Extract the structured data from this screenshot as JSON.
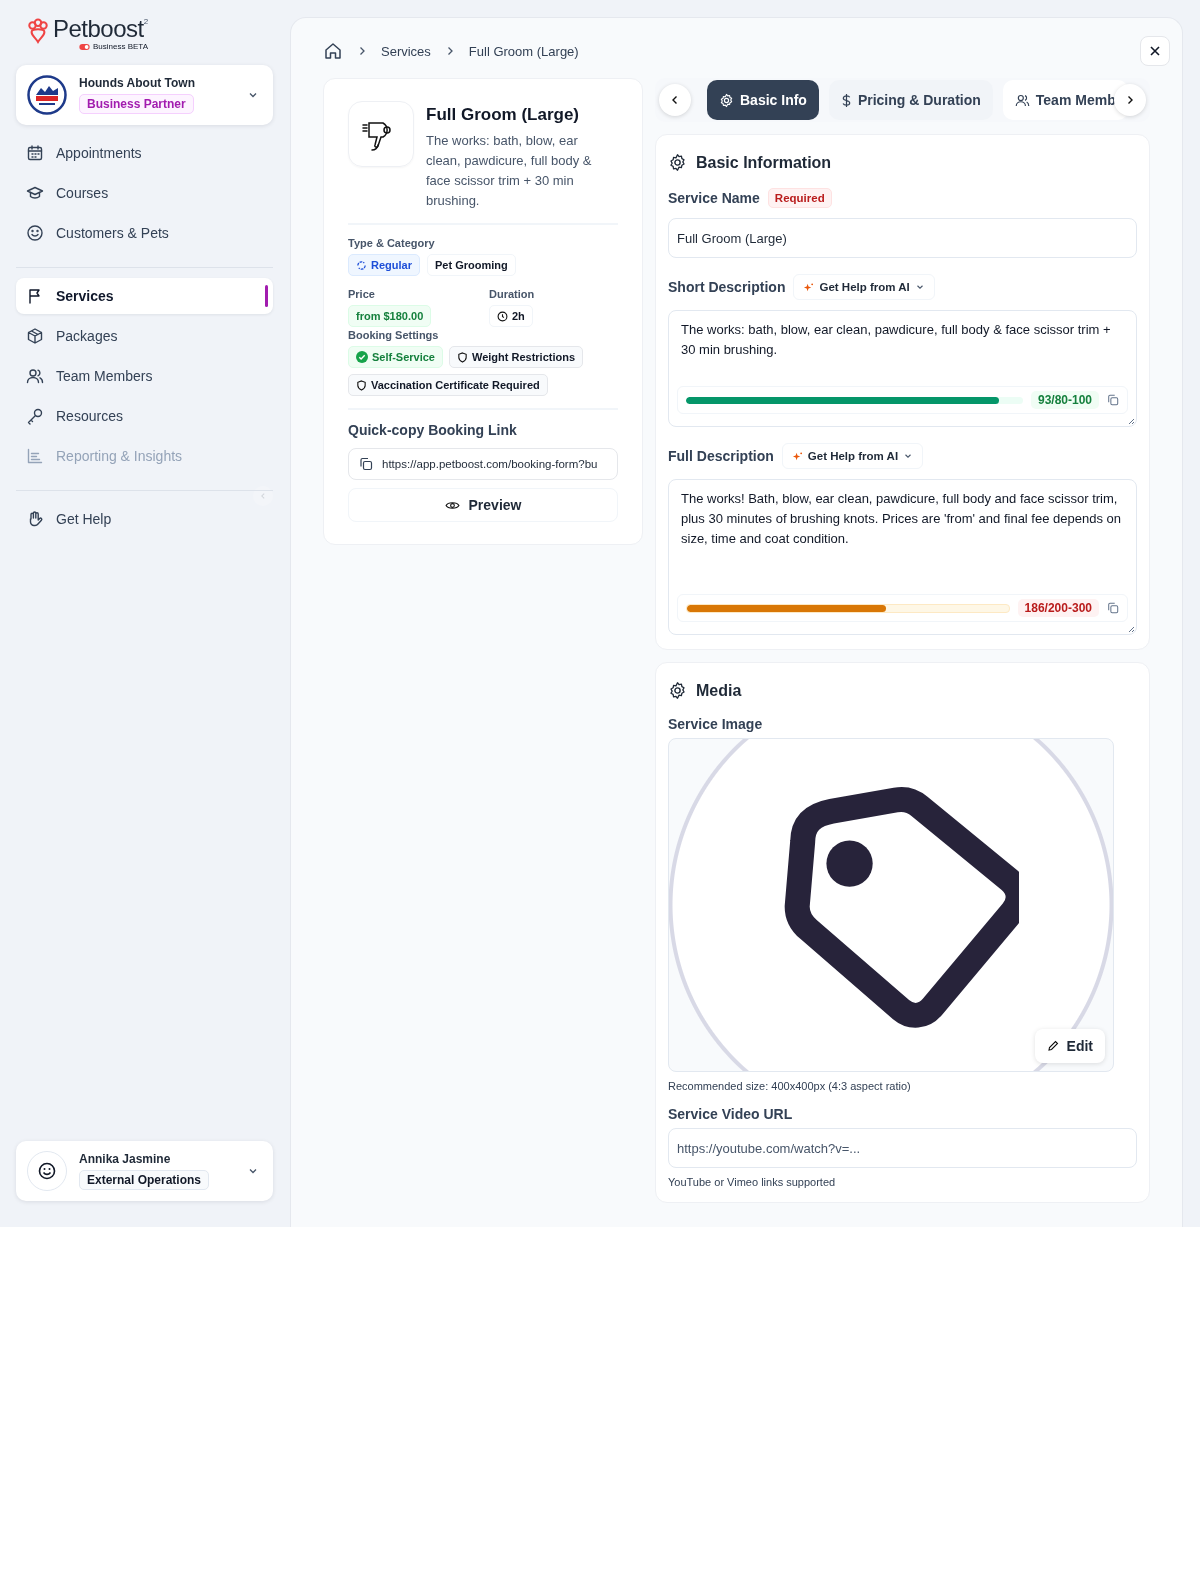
{
  "brand": {
    "name": "Petboost",
    "mark": "2",
    "edition": "Business BETA"
  },
  "business": {
    "name": "Hounds About Town",
    "role": "Business Partner"
  },
  "nav": [
    [
      {
        "label": "Appointments",
        "selected": false,
        "disabled": false
      },
      {
        "label": "Courses",
        "selected": false,
        "disabled": false
      },
      {
        "label": "Customers & Pets",
        "selected": false,
        "disabled": false
      }
    ],
    [
      {
        "label": "Services",
        "selected": true,
        "disabled": false
      },
      {
        "label": "Packages",
        "selected": false,
        "disabled": false
      },
      {
        "label": "Team Members",
        "selected": false,
        "disabled": false
      },
      {
        "label": "Resources",
        "selected": false,
        "disabled": false
      },
      {
        "label": "Reporting & Insights",
        "selected": false,
        "disabled": true
      }
    ],
    [
      {
        "label": "Get Help",
        "selected": false,
        "disabled": false
      }
    ]
  ],
  "user": {
    "name": "Annika Jasmine",
    "role": "External Operations"
  },
  "breadcrumb": [
    "Services",
    "Full Groom (Large)"
  ],
  "summary": {
    "title": "Full Groom (Large)",
    "description": "The works: bath, blow, ear clean, pawdicure, full body & face scissor trim + 30 min brushing.",
    "type_label": "Type & Category",
    "type": "Regular",
    "category": "Pet Grooming",
    "price_label": "Price",
    "price": "from $180.00",
    "duration_label": "Duration",
    "duration": "2h",
    "booking_label": "Booking Settings",
    "booking_settings": [
      {
        "label": "Self-Service",
        "kind": "enabled"
      },
      {
        "label": "Weight Restrictions",
        "kind": "rule"
      },
      {
        "label": "Vaccination Certificate Required",
        "kind": "rule"
      }
    ],
    "link_label": "Quick-copy Booking Link",
    "link": "https://app.petboost.com/booking-form?bu",
    "preview": "Preview"
  },
  "tabs": [
    {
      "label": "Basic Info",
      "selected": true
    },
    {
      "label": "Pricing & Duration",
      "selected": false
    },
    {
      "label": "Team Memb",
      "selected": false
    }
  ],
  "basic": {
    "title": "Basic Information",
    "name_label": "Service Name",
    "required": "Required",
    "name_value": "Full Groom (Large)",
    "descriptions": [
      {
        "label": "Short Description",
        "ai": "Get Help from AI",
        "value": "The works: bath, blow, ear clean, pawdicure, full body & face scissor trim + 30 min brushing.",
        "level": 0.93,
        "count": "93/80-100",
        "kind": "within"
      },
      {
        "label": "Full Description",
        "ai": "Get Help from AI",
        "value": "The works! Bath, blow, ear clean, pawdicure, full body and face scissor trim, plus 30 minutes of brushing knots. Prices are 'from' and final fee depends on size, time and coat condition.",
        "level": 0.62,
        "count": "186/200-300",
        "kind": "under"
      }
    ]
  },
  "media": {
    "title": "Media",
    "image_label": "Service Image",
    "edit": "Edit",
    "image_hint": "Recommended size: 400x400px (4:3 aspect ratio)",
    "video_label": "Service Video URL",
    "video_placeholder": "https://youtube.com/watch?v=...",
    "video_hint": "YouTube or Vimeo links supported"
  }
}
